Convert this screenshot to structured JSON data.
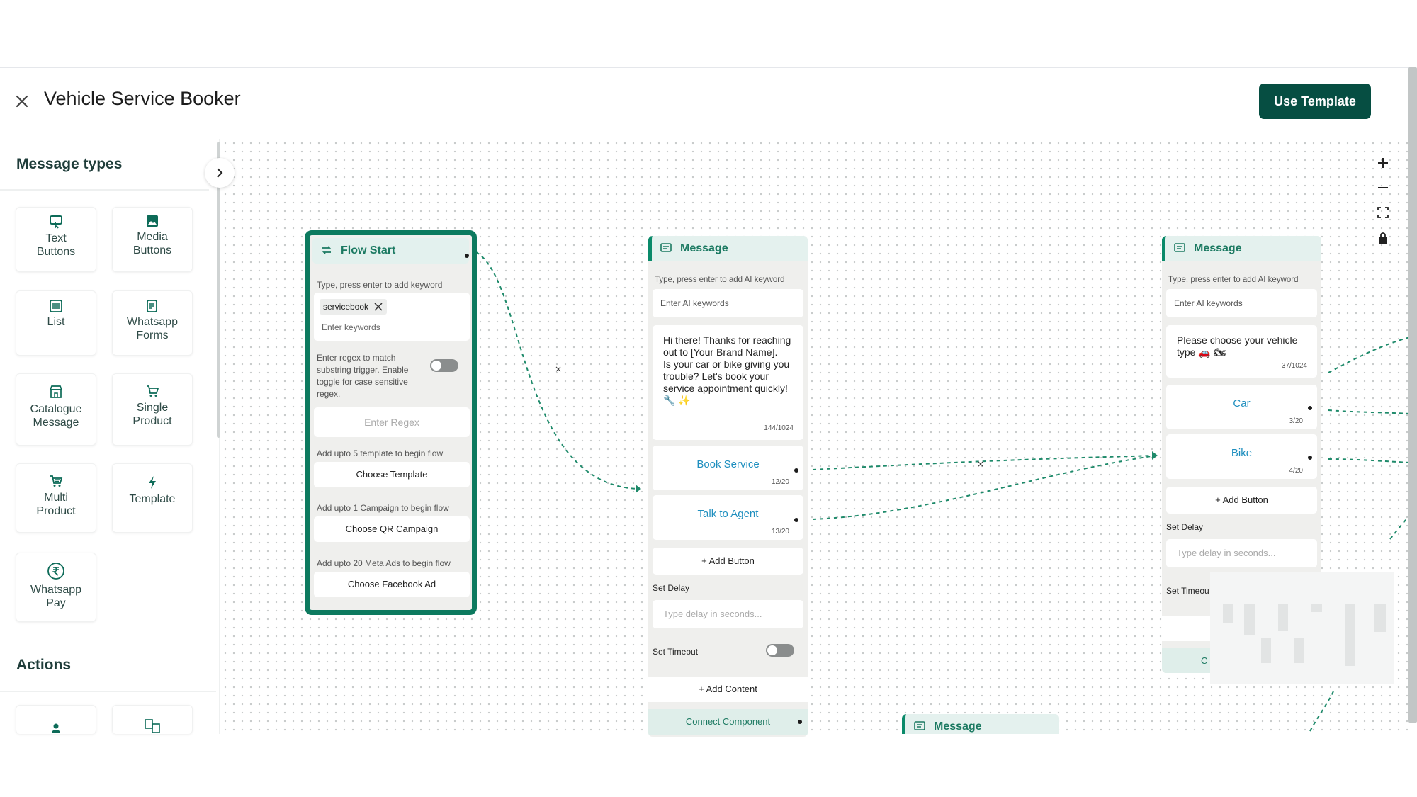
{
  "header": {
    "title": "Vehicle Service Booker",
    "use_template_label": "Use Template"
  },
  "sidebar": {
    "message_types_title": "Message types",
    "actions_title": "Actions",
    "tiles": [
      {
        "label": "Text\nButtons",
        "icon": "text-buttons-icon"
      },
      {
        "label": "Media\nButtons",
        "icon": "image-icon"
      },
      {
        "label": "List",
        "icon": "list-icon"
      },
      {
        "label": "Whatsapp\nForms",
        "icon": "form-icon"
      },
      {
        "label": "Catalogue\nMessage",
        "icon": "catalogue-icon"
      },
      {
        "label": "Single\nProduct",
        "icon": "cart-icon"
      },
      {
        "label": "Multi\nProduct",
        "icon": "cart-icon"
      },
      {
        "label": "Template",
        "icon": "bolt-icon"
      },
      {
        "label": "Whatsapp\nPay",
        "icon": "rupee-icon"
      }
    ]
  },
  "flow_start": {
    "title": "Flow Start",
    "keyword_hint": "Type, press enter to add keyword",
    "keyword_chip": "servicebook",
    "keyword_placeholder": "Enter keywords",
    "regex_hint": "Enter regex to match substring trigger. Enable toggle for case sensitive regex.",
    "regex_placeholder": "Enter Regex",
    "template_hint": "Add upto 5 template to begin flow",
    "template_button": "Choose Template",
    "campaign_hint": "Add upto 1 Campaign to begin flow",
    "campaign_button": "Choose QR Campaign",
    "ads_hint": "Add upto 20 Meta Ads to begin flow",
    "ads_button": "Choose Facebook Ad"
  },
  "message_1": {
    "title": "Message",
    "keyword_hint": "Type, press enter to add AI keyword",
    "keyword_placeholder": "Enter AI keywords",
    "body": "Hi there! Thanks for reaching out to [Your Brand Name].\nIs your car or bike giving you trouble? Let's book your service appointment quickly! 🔧 ✨",
    "body_count": "144/1024",
    "buttons": [
      {
        "label": "Book Service",
        "count": "12/20"
      },
      {
        "label": "Talk to Agent",
        "count": "13/20"
      }
    ],
    "add_button": "+ Add Button",
    "delay_label": "Set Delay",
    "delay_placeholder": "Type delay in seconds...",
    "timeout_label": "Set Timeout",
    "add_content": "+ Add Content",
    "connect_component": "Connect Component"
  },
  "message_2": {
    "title": "Message",
    "keyword_hint": "Type, press enter to add AI keyword",
    "keyword_placeholder": "Enter AI keywords",
    "body": "Please choose your vehicle type 🚗 🏍",
    "body_count": "37/1024",
    "buttons": [
      {
        "label": "Car",
        "count": "3/20"
      },
      {
        "label": "Bike",
        "count": "4/20"
      }
    ],
    "add_button": "+ Add Button",
    "delay_label": "Set Delay",
    "delay_placeholder": "Type delay in seconds...",
    "timeout_label": "Set Timeou",
    "connect_partial": "C"
  },
  "message_3": {
    "title": "Message"
  },
  "edge_delete_glyph": "×",
  "colors": {
    "brand_dark": "#064e42",
    "accent_green": "#0a8a6a",
    "link_blue": "#1f8fbf"
  }
}
